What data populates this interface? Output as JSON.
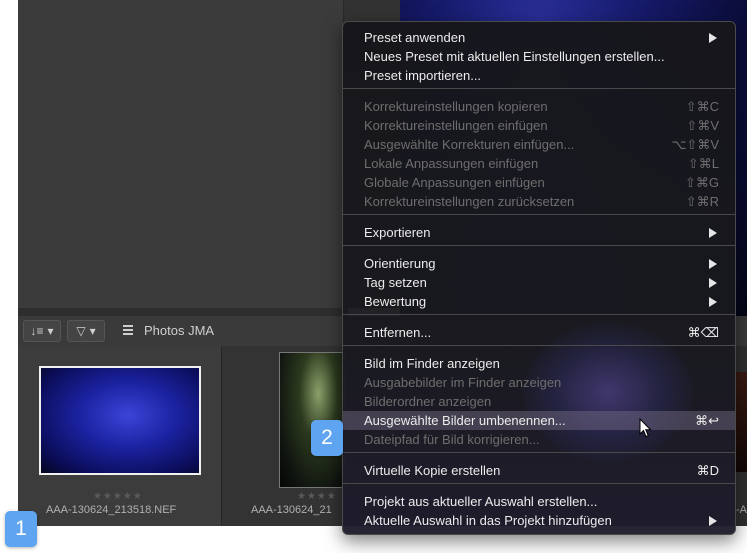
{
  "toolbar": {
    "sort_icon": "sort-icon",
    "filter_icon": "filter-icon",
    "grid_icon": "grid-icon",
    "album_label": "Photos JMA"
  },
  "filmstrip": {
    "items": [
      {
        "filename": "AAA-130624_213518.NEF",
        "rating": "★★★★★"
      },
      {
        "filename": "AAA-130624_21",
        "rating": "★★★★"
      },
      {
        "filename": "-A",
        "rating": ""
      }
    ]
  },
  "badges": {
    "one": "1",
    "two": "2"
  },
  "menu": {
    "items": [
      {
        "label": "Preset anwenden",
        "shortcut": "",
        "submenu": true,
        "disabled": false
      },
      {
        "label": "Neues Preset mit aktuellen Einstellungen erstellen...",
        "shortcut": "",
        "submenu": false,
        "disabled": false
      },
      {
        "label": "Preset importieren...",
        "shortcut": "",
        "submenu": false,
        "disabled": false
      },
      {
        "label": "Korrektureinstellungen kopieren",
        "shortcut": "⇧⌘C",
        "submenu": false,
        "disabled": true
      },
      {
        "label": "Korrektureinstellungen einfügen",
        "shortcut": "⇧⌘V",
        "submenu": false,
        "disabled": true
      },
      {
        "label": "Ausgewählte Korrekturen einfügen...",
        "shortcut": "⌥⇧⌘V",
        "submenu": false,
        "disabled": true
      },
      {
        "label": "Lokale Anpassungen einfügen",
        "shortcut": "⇧⌘L",
        "submenu": false,
        "disabled": true
      },
      {
        "label": "Globale Anpassungen einfügen",
        "shortcut": "⇧⌘G",
        "submenu": false,
        "disabled": true
      },
      {
        "label": "Korrektureinstellungen zurücksetzen",
        "shortcut": "⇧⌘R",
        "submenu": false,
        "disabled": true
      },
      {
        "label": "Exportieren",
        "shortcut": "",
        "submenu": true,
        "disabled": false
      },
      {
        "label": "Orientierung",
        "shortcut": "",
        "submenu": true,
        "disabled": false
      },
      {
        "label": "Tag setzen",
        "shortcut": "",
        "submenu": true,
        "disabled": false
      },
      {
        "label": "Bewertung",
        "shortcut": "",
        "submenu": true,
        "disabled": false
      },
      {
        "label": "Entfernen...",
        "shortcut": "⌘⌫",
        "submenu": false,
        "disabled": false
      },
      {
        "label": "Bild im Finder anzeigen",
        "shortcut": "",
        "submenu": false,
        "disabled": false
      },
      {
        "label": "Ausgabebilder im Finder anzeigen",
        "shortcut": "",
        "submenu": false,
        "disabled": true
      },
      {
        "label": "Bilderordner anzeigen",
        "shortcut": "",
        "submenu": false,
        "disabled": true
      },
      {
        "label": "Ausgewählte Bilder umbenennen...",
        "shortcut": "⌘↩",
        "submenu": false,
        "disabled": false,
        "highlighted": true
      },
      {
        "label": "Dateipfad für Bild korrigieren...",
        "shortcut": "",
        "submenu": false,
        "disabled": true
      },
      {
        "label": "Virtuelle Kopie erstellen",
        "shortcut": "⌘D",
        "submenu": false,
        "disabled": false
      },
      {
        "label": "Projekt aus aktueller Auswahl erstellen...",
        "shortcut": "",
        "submenu": false,
        "disabled": false
      },
      {
        "label": "Aktuelle Auswahl in das Projekt hinzufügen",
        "shortcut": "",
        "submenu": true,
        "disabled": false
      }
    ]
  }
}
